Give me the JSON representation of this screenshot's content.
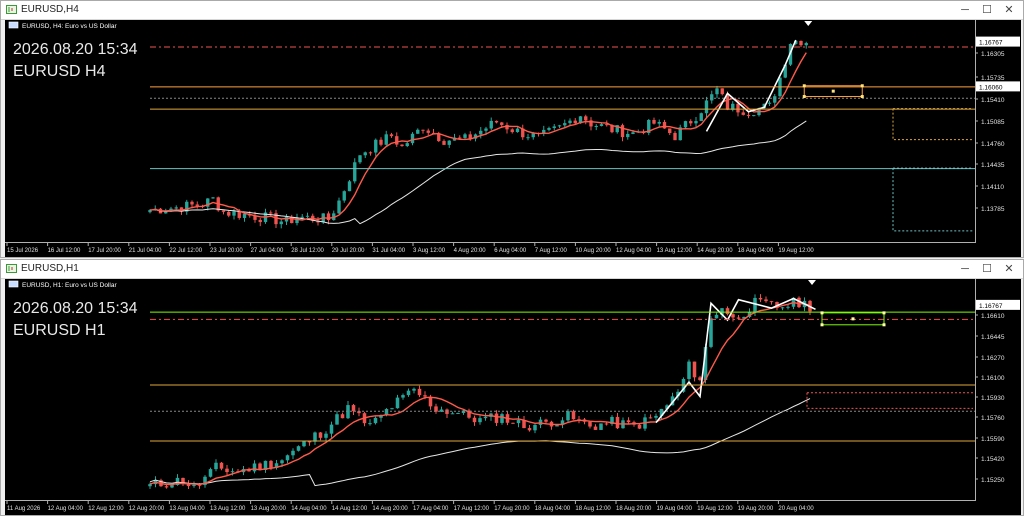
{
  "colors": {
    "background": "#000000",
    "bull": "#26a69a",
    "bear": "#ef5350",
    "fast_ma": "#ff5a4a",
    "slow_ma": "#e6e6e6",
    "zigzag": "#ffffff",
    "level_orange": "#ffa040",
    "level_gold": "#e0a93b",
    "level_cyan": "#6ec3c3",
    "level_green": "#7cfc00"
  },
  "windows": [
    {
      "title": "EURUSD,H4",
      "header": "EURUSD, H4:  Euro vs US Dollar",
      "overlay_time": "2026.08.20 15:34",
      "overlay_symbol": "EURUSD H4",
      "price_label": "1.16767",
      "hline_label": "1.16060",
      "y_ticks": [
        "1.16305",
        "1.15735",
        "1.15410",
        "1.15085",
        "1.14760",
        "1.14435",
        "1.14110",
        "1.13785"
      ],
      "x_ticks": [
        "15 Jul 2026",
        "16 Jul 12:00",
        "17 Jul 20:00",
        "21 Jul 04:00",
        "22 Jul 12:00",
        "23 Jul 20:00",
        "27 Jul 04:00",
        "28 Jul 12:00",
        "29 Jul 20:00",
        "31 Jul 04:00",
        "3 Aug 12:00",
        "4 Aug 20:00",
        "6 Aug 04:00",
        "7 Aug 12:00",
        "10 Aug 20:00",
        "12 Aug 04:00",
        "13 Aug 12:00",
        "14 Aug 20:00",
        "18 Aug 04:00",
        "19 Aug 12:00"
      ],
      "chart_data": {
        "type": "candlestick",
        "symbol": "EURUSD",
        "timeframe": "H4",
        "ylim": [
          1.1362,
          1.1695
        ],
        "price_marker": 1.16767,
        "levels": [
          {
            "price": 1.1669,
            "style": "dash-dot",
            "color": "#ef5350"
          },
          {
            "price": 1.1606,
            "style": "solid",
            "color": "#ffa040"
          },
          {
            "price": 1.1588,
            "style": "dotted",
            "color": "#888888"
          },
          {
            "price": 1.1571,
            "style": "solid",
            "color": "#e0a93b"
          },
          {
            "price": 1.1477,
            "style": "solid",
            "color": "#6ec3c3"
          }
        ],
        "anchors": [
          {
            "i": 0,
            "p": 1.1411
          },
          {
            "i": 5,
            "p": 1.1415
          },
          {
            "i": 10,
            "p": 1.142
          },
          {
            "i": 12,
            "p": 1.1428
          },
          {
            "i": 14,
            "p": 1.1408
          },
          {
            "i": 22,
            "p": 1.1399
          },
          {
            "i": 26,
            "p": 1.1392
          },
          {
            "i": 28,
            "p": 1.14
          },
          {
            "i": 34,
            "p": 1.1396
          },
          {
            "i": 36,
            "p": 1.1425
          },
          {
            "i": 40,
            "p": 1.15
          },
          {
            "i": 46,
            "p": 1.1528
          },
          {
            "i": 48,
            "p": 1.151
          },
          {
            "i": 52,
            "p": 1.1543
          },
          {
            "i": 56,
            "p": 1.1522
          },
          {
            "i": 60,
            "p": 1.1522
          },
          {
            "i": 66,
            "p": 1.155
          },
          {
            "i": 70,
            "p": 1.1535
          },
          {
            "i": 74,
            "p": 1.1525
          },
          {
            "i": 78,
            "p": 1.154
          },
          {
            "i": 82,
            "p": 1.1562
          },
          {
            "i": 84,
            "p": 1.1548
          },
          {
            "i": 88,
            "p": 1.1538
          },
          {
            "i": 92,
            "p": 1.1532
          },
          {
            "i": 96,
            "p": 1.1548
          },
          {
            "i": 100,
            "p": 1.1528
          },
          {
            "i": 104,
            "p": 1.156
          },
          {
            "i": 108,
            "p": 1.16
          },
          {
            "i": 110,
            "p": 1.1574
          },
          {
            "i": 114,
            "p": 1.1568
          },
          {
            "i": 118,
            "p": 1.1574
          },
          {
            "i": 120,
            "p": 1.162
          },
          {
            "i": 122,
            "p": 1.1677
          },
          {
            "i": 124,
            "p": 1.1679
          },
          {
            "i": 125,
            "p": 1.1677
          }
        ],
        "zigzag": [
          {
            "i": 106,
            "p": 1.1535
          },
          {
            "i": 110,
            "p": 1.1595
          },
          {
            "i": 114,
            "p": 1.1566
          },
          {
            "i": 117,
            "p": 1.1573
          },
          {
            "i": 121,
            "p": 1.164
          },
          {
            "i": 123,
            "p": 1.1679
          }
        ]
      }
    },
    {
      "title": "EURUSD,H1",
      "header": "EURUSD, H1:  Euro vs US Dollar",
      "overlay_time": "2026.08.20 15:34",
      "overlay_symbol": "EURUSD H1",
      "price_label": "1.16767",
      "hline_label": "",
      "y_ticks": [
        "1.16610",
        "1.16445",
        "1.16270",
        "1.16100",
        "1.15930",
        "1.15760",
        "1.15590",
        "1.15420",
        "1.15250"
      ],
      "x_ticks": [
        "11 Aug 2026",
        "12 Aug 04:00",
        "12 Aug 12:00",
        "12 Aug 20:00",
        "13 Aug 04:00",
        "13 Aug 12:00",
        "13 Aug 20:00",
        "14 Aug 04:00",
        "14 Aug 12:00",
        "14 Aug 20:00",
        "17 Aug 04:00",
        "17 Aug 12:00",
        "17 Aug 20:00",
        "18 Aug 04:00",
        "18 Aug 12:00",
        "18 Aug 20:00",
        "19 Aug 04:00",
        "19 Aug 12:00",
        "19 Aug 20:00",
        "20 Aug 04:00"
      ],
      "chart_data": {
        "type": "candlestick",
        "symbol": "EURUSD",
        "timeframe": "H1",
        "ylim": [
          1.1514,
          1.169
        ],
        "price_marker": 1.16767,
        "levels": [
          {
            "price": 1.1671,
            "style": "solid",
            "color": "#7cfc00"
          },
          {
            "price": 1.1665,
            "style": "dash-dot",
            "color": "#ef5350"
          },
          {
            "price": 1.161,
            "style": "solid",
            "color": "#e0a93b"
          },
          {
            "price": 1.1588,
            "style": "dotted",
            "color": "#888888"
          },
          {
            "price": 1.1563,
            "style": "solid",
            "color": "#e0a93b"
          }
        ],
        "anchors": [
          {
            "i": 0,
            "p": 1.1525
          },
          {
            "i": 6,
            "p": 1.153
          },
          {
            "i": 8,
            "p": 1.1523
          },
          {
            "i": 12,
            "p": 1.154
          },
          {
            "i": 16,
            "p": 1.1537
          },
          {
            "i": 20,
            "p": 1.1542
          },
          {
            "i": 24,
            "p": 1.1547
          },
          {
            "i": 28,
            "p": 1.156
          },
          {
            "i": 32,
            "p": 1.1573
          },
          {
            "i": 36,
            "p": 1.159
          },
          {
            "i": 40,
            "p": 1.1575
          },
          {
            "i": 44,
            "p": 1.1592
          },
          {
            "i": 48,
            "p": 1.1605
          },
          {
            "i": 52,
            "p": 1.159
          },
          {
            "i": 56,
            "p": 1.1586
          },
          {
            "i": 60,
            "p": 1.158
          },
          {
            "i": 64,
            "p": 1.1583
          },
          {
            "i": 68,
            "p": 1.1575
          },
          {
            "i": 72,
            "p": 1.1578
          },
          {
            "i": 76,
            "p": 1.1583
          },
          {
            "i": 80,
            "p": 1.1575
          },
          {
            "i": 84,
            "p": 1.1578
          },
          {
            "i": 88,
            "p": 1.1575
          },
          {
            "i": 92,
            "p": 1.1583
          },
          {
            "i": 96,
            "p": 1.1603
          },
          {
            "i": 98,
            "p": 1.1625
          },
          {
            "i": 100,
            "p": 1.1615
          },
          {
            "i": 102,
            "p": 1.1665
          },
          {
            "i": 104,
            "p": 1.1676
          },
          {
            "i": 106,
            "p": 1.1664
          },
          {
            "i": 110,
            "p": 1.1678
          },
          {
            "i": 114,
            "p": 1.1675
          },
          {
            "i": 118,
            "p": 1.1679
          },
          {
            "i": 120,
            "p": 1.1676
          }
        ],
        "zigzag": [
          {
            "i": 92,
            "p": 1.1578
          },
          {
            "i": 98,
            "p": 1.1612
          },
          {
            "i": 100,
            "p": 1.16
          },
          {
            "i": 102,
            "p": 1.1678
          },
          {
            "i": 105,
            "p": 1.1664
          },
          {
            "i": 107,
            "p": 1.1681
          },
          {
            "i": 113,
            "p": 1.1674
          },
          {
            "i": 117,
            "p": 1.1682
          },
          {
            "i": 121,
            "p": 1.1673
          }
        ]
      }
    }
  ]
}
